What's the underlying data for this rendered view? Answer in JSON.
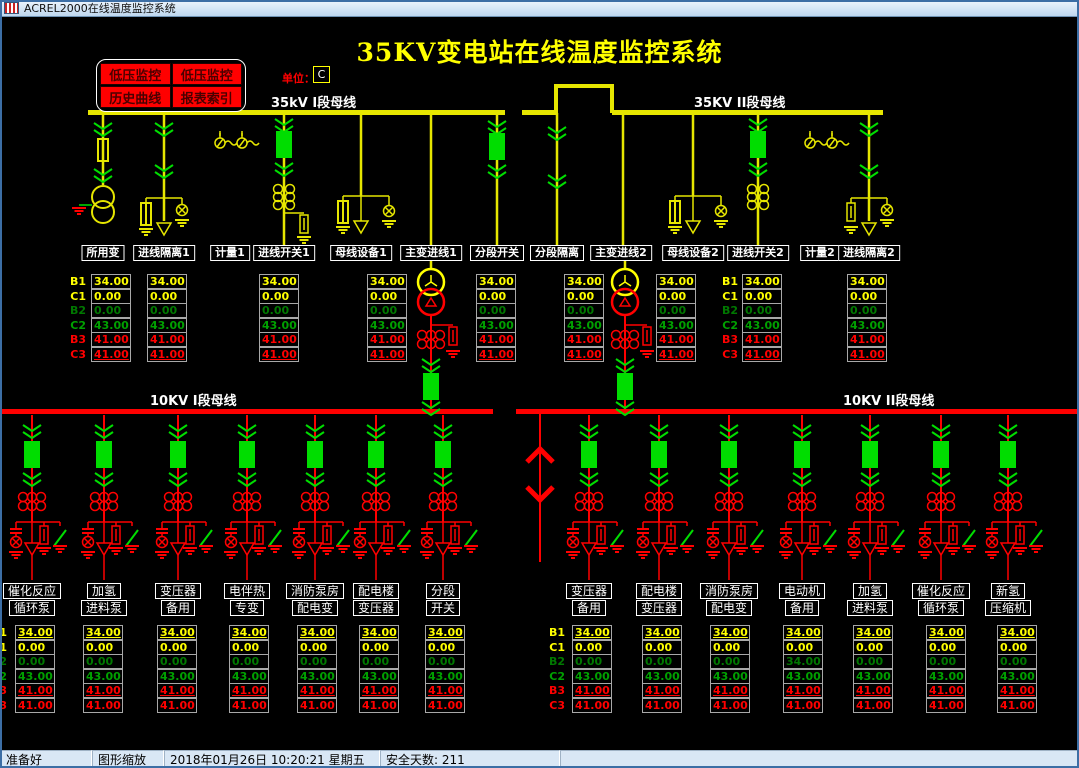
{
  "window": {
    "title": "ACREL2000在线温度监控系统"
  },
  "header": {
    "title": "35KV变电站在线温度监控系统",
    "unit_label": "单位：",
    "unit_value": "C"
  },
  "menu": {
    "items": [
      "低压监控",
      "低压监控",
      "历史曲线",
      "报表索引"
    ]
  },
  "bus_labels": {
    "bus35_1": "35kV I段母线",
    "bus35_2": "35KV II段母线",
    "bus10_1": "10KV I段母线",
    "bus10_2": "10KV II段母线"
  },
  "upper_bays": [
    "所用变",
    "进线隔离1",
    "计量1",
    "进线开关1",
    "母线设备1",
    "主变进线1",
    "分段开关",
    "分段隔离",
    "主变进线2",
    "母线设备2",
    "进线开关2",
    "计量2",
    "进线隔离2"
  ],
  "row_labels": [
    "B1",
    "C1",
    "B2",
    "C2",
    "B3",
    "C3"
  ],
  "phase_colors": [
    "#ffff00",
    "#ffff00",
    "#007800",
    "#00a000",
    "#ff0000",
    "#ff0000"
  ],
  "colors": {
    "bus_35kv": "#e6e600",
    "bus_10kv": "#ff0000",
    "breaker_closed": "#00dd00",
    "title_yellow": "#ffff00",
    "alarm_red": "#ff0000",
    "label_white": "#ffffff"
  },
  "upper_tables": {
    "columns": [
      {
        "values": [
          "34.00",
          "0.00",
          "0.00",
          "43.00",
          "41.00",
          "41.00"
        ]
      },
      {
        "values": [
          "34.00",
          "0.00",
          "0.00",
          "43.00",
          "41.00",
          "41.00"
        ]
      },
      {
        "values": [
          "34.00",
          "0.00",
          "0.00",
          "43.00",
          "41.00",
          "41.00"
        ]
      },
      {
        "values": [
          "34.00",
          "0.00",
          "0.00",
          "43.00",
          "41.00",
          "41.00"
        ]
      },
      {
        "values": [
          "34.00",
          "0.00",
          "0.00",
          "43.00",
          "41.00",
          "41.00"
        ]
      },
      {
        "values": [
          "34.00",
          "0.00",
          "0.00",
          "43.00",
          "41.00",
          "41.00"
        ]
      },
      {
        "values": [
          "34.00",
          "0.00",
          "0.00",
          "43.00",
          "41.00",
          "41.00"
        ]
      },
      {
        "values": [
          "34.00",
          "0.00",
          "0.00",
          "43.00",
          "41.00",
          "41.00"
        ]
      },
      {
        "values": [
          "34.00",
          "0.00",
          "0.00",
          "43.00",
          "41.00",
          "41.00"
        ]
      }
    ]
  },
  "lower_bays": [
    {
      "line1": "催化反应",
      "line2": "循环泵"
    },
    {
      "line1": "加氢",
      "line2": "进料泵"
    },
    {
      "line1": "变压器",
      "line2": "备用"
    },
    {
      "line1": "电伴热",
      "line2": "专变"
    },
    {
      "line1": "消防泵房",
      "line2": "配电变"
    },
    {
      "line1": "配电楼",
      "line2": "变压器"
    },
    {
      "line1": "分段",
      "line2": "开关"
    },
    {
      "line1": "变压器",
      "line2": "备用"
    },
    {
      "line1": "配电楼",
      "line2": "变压器"
    },
    {
      "line1": "消防泵房",
      "line2": "配电变"
    },
    {
      "line1": "电动机",
      "line2": "备用"
    },
    {
      "line1": "加氢",
      "line2": "进料泵"
    },
    {
      "line1": "催化反应",
      "line2": "循环泵"
    },
    {
      "line1": "新氢",
      "line2": "压缩机"
    }
  ],
  "lower_tables": {
    "left_columns": [
      {
        "values": [
          "34.00",
          "0.00",
          "0.00",
          "43.00",
          "41.00",
          "41.00"
        ]
      },
      {
        "values": [
          "34.00",
          "0.00",
          "0.00",
          "43.00",
          "41.00",
          "41.00"
        ]
      },
      {
        "values": [
          "34.00",
          "0.00",
          "0.00",
          "43.00",
          "41.00",
          "41.00"
        ]
      },
      {
        "values": [
          "34.00",
          "0.00",
          "0.00",
          "43.00",
          "41.00",
          "41.00"
        ]
      },
      {
        "values": [
          "34.00",
          "0.00",
          "0.00",
          "43.00",
          "41.00",
          "41.00"
        ]
      },
      {
        "values": [
          "34.00",
          "0.00",
          "0.00",
          "43.00",
          "41.00",
          "41.00"
        ]
      },
      {
        "values": [
          "34.00",
          "0.00",
          "0.00",
          "43.00",
          "41.00",
          "41.00"
        ]
      }
    ],
    "right_columns": [
      {
        "values": [
          "34.00",
          "0.00",
          "0.00",
          "43.00",
          "41.00",
          "41.00"
        ]
      },
      {
        "values": [
          "34.00",
          "0.00",
          "0.00",
          "43.00",
          "41.00",
          "41.00"
        ]
      },
      {
        "values": [
          "34.00",
          "0.00",
          "0.00",
          "43.00",
          "41.00",
          "41.00"
        ]
      },
      {
        "values": [
          "34.00",
          "0.00",
          "34.00",
          "43.00",
          "41.00",
          "41.00"
        ]
      },
      {
        "values": [
          "34.00",
          "0.00",
          "0.00",
          "43.00",
          "41.00",
          "41.00"
        ]
      },
      {
        "values": [
          "34.00",
          "0.00",
          "0.00",
          "43.00",
          "41.00",
          "41.00"
        ]
      },
      {
        "values": [
          "34.00",
          "0.00",
          "0.00",
          "43.00",
          "41.00",
          "41.00"
        ]
      }
    ]
  },
  "status_bar": {
    "ready": "准备好",
    "mode": "图形缩放",
    "datetime": "2018年01月26日  10:20:21  星期五",
    "safety_days": "安全天数: 211"
  }
}
